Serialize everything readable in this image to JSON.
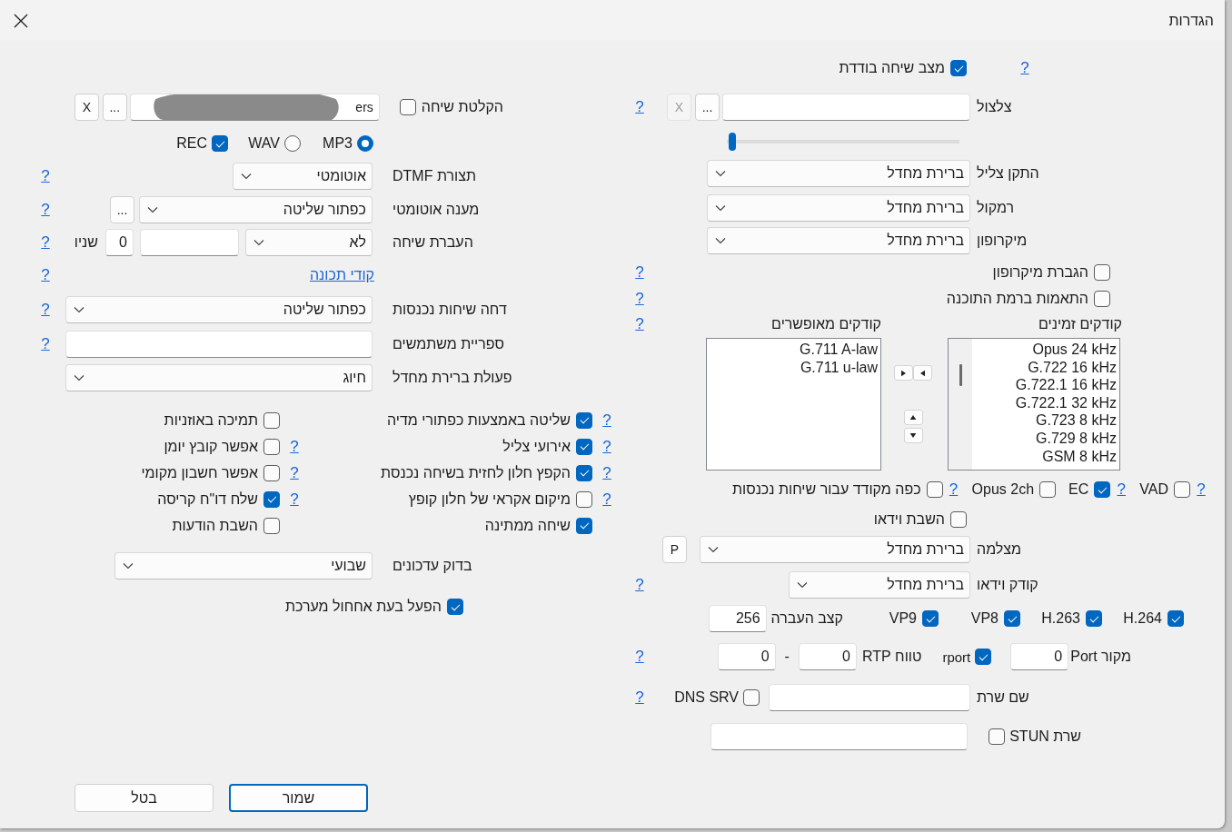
{
  "window": {
    "title": "הגדרות"
  },
  "single_call_mode": {
    "label": "מצב שיחה בודדת",
    "checked": true,
    "help": "?"
  },
  "ringtone": {
    "label": "צלצול",
    "browse": "...",
    "clear": "X",
    "clear_disabled": true,
    "help": "?",
    "volume": {
      "level": 0.01
    }
  },
  "devices": [
    {
      "label": "התקן צליל",
      "value": "ברירת מחדל"
    },
    {
      "label": "רמקול",
      "value": "ברירת מחדל"
    },
    {
      "label": "מיקרופון",
      "value": "ברירת מחדל"
    }
  ],
  "audio_options": [
    {
      "label": "הגברת מיקרופון",
      "checked": false,
      "help": "?"
    },
    {
      "label": "התאמות ברמת התוכנה",
      "checked": false,
      "help": "?"
    }
  ],
  "codecs": {
    "available_title": "קודקים זמינים",
    "enabled_title": "קודקים מאופשרים",
    "help": "?",
    "available": [
      "Opus 24 kHz",
      "G.722 16 kHz",
      "G.722.1 16 kHz",
      "G.722.1 32 kHz",
      "G.723 8 kHz",
      "G.729 8 kHz",
      "GSM 8 kHz"
    ],
    "enabled": [
      "G.711 A-law",
      "G.711 u-law"
    ]
  },
  "codec_flags": [
    {
      "help": "?",
      "label": "VAD",
      "checked": false
    },
    {
      "help": "?",
      "label": "EC",
      "checked": true
    },
    {
      "label": "Opus 2ch",
      "checked": false
    },
    {
      "help": "?",
      "label": "כפה מקודד עבור שיחות נכנסות",
      "checked": false
    }
  ],
  "disable_video": {
    "label": "השבת וידאו",
    "checked": false
  },
  "camera": {
    "label": "מצלמה",
    "value": "ברירת מחדל",
    "button": "P"
  },
  "video_codec": {
    "label": "קודק וידאו",
    "value": "ברירת מחדל",
    "help": "?"
  },
  "video_codecs": [
    {
      "label": "H.264",
      "checked": true
    },
    {
      "label": "H.263",
      "checked": true
    },
    {
      "label": "VP8",
      "checked": true
    },
    {
      "label": "VP9",
      "checked": true
    }
  ],
  "bitrate": {
    "label": "קצב העברה",
    "value": "256"
  },
  "ports": {
    "source_label": "מקור Port",
    "source_value": "0",
    "rport": {
      "label": "rport",
      "checked": true
    },
    "rtp_label": "טווח RTP",
    "rtp_from": "0",
    "separator": "-",
    "rtp_to": "0",
    "help": "?"
  },
  "server": {
    "label": "שם שרת",
    "dns_srv": {
      "label": "DNS SRV",
      "checked": false
    },
    "help": "?"
  },
  "stun": {
    "label": "שרת STUN",
    "checked": false
  },
  "recording": {
    "label": "הקלטת שיחה",
    "checked": false,
    "path": "ers",
    "redacted": true,
    "browse": "...",
    "clear": "X",
    "formats": [
      {
        "label": "MP3",
        "selected": true
      },
      {
        "label": "WAV",
        "selected": false
      }
    ],
    "rec": {
      "label": "REC",
      "checked": true
    }
  },
  "dtmf": {
    "label": "תצורת DTMF",
    "value": "אוטומטי",
    "help": "?"
  },
  "auto_answer": {
    "label": "מענה אוטומטי",
    "value": "כפתור שליטה",
    "browse": "...",
    "help": "?"
  },
  "forwarding": {
    "label": "העברת שיחה",
    "value": "לא",
    "delay": "0",
    "unit": "שניו",
    "help": "?"
  },
  "feature_codes": {
    "link": "קודי תכונה",
    "help": "?"
  },
  "deny_incoming": {
    "label": "דחה שיחות נכנסות",
    "value": "כפתור שליטה",
    "help": "?"
  },
  "directory": {
    "label": "ספריית משתמשים",
    "help": "?"
  },
  "default_action": {
    "label": "פעולת ברירת מחדל",
    "value": "חיוג"
  },
  "options": [
    {
      "label": "שליטה באמצעות כפתורי מדיה",
      "checked": true,
      "help": "?"
    },
    {
      "label": "תמיכה באוזניות",
      "checked": false
    },
    {
      "label": "אירועי צליל",
      "checked": true,
      "help": "?"
    },
    {
      "label": "אפשר קובץ יומן",
      "checked": false,
      "help": "?"
    },
    {
      "label": "הקפץ חלון לחזית בשיחה נכנסת",
      "checked": true,
      "help": "?"
    },
    {
      "label": "אפשר חשבון מקומי",
      "checked": false,
      "help": "?"
    },
    {
      "label": "מיקום אקראי של חלון קופץ",
      "checked": false,
      "help": "?"
    },
    {
      "label": "שלח דו\"ח קריסה",
      "checked": true,
      "help": "?"
    },
    {
      "label": "שיחה ממתינה",
      "checked": true
    },
    {
      "label": "השבת הודעות",
      "checked": false
    }
  ],
  "updates": {
    "label": "בדוק עדכונים",
    "value": "שבועי"
  },
  "autostart": {
    "label": "הפעל בעת אחחול מערכת",
    "checked": true
  },
  "buttons": [
    {
      "label": "שמור",
      "kind": "primary"
    },
    {
      "label": "בטל",
      "kind": "secondary"
    }
  ]
}
